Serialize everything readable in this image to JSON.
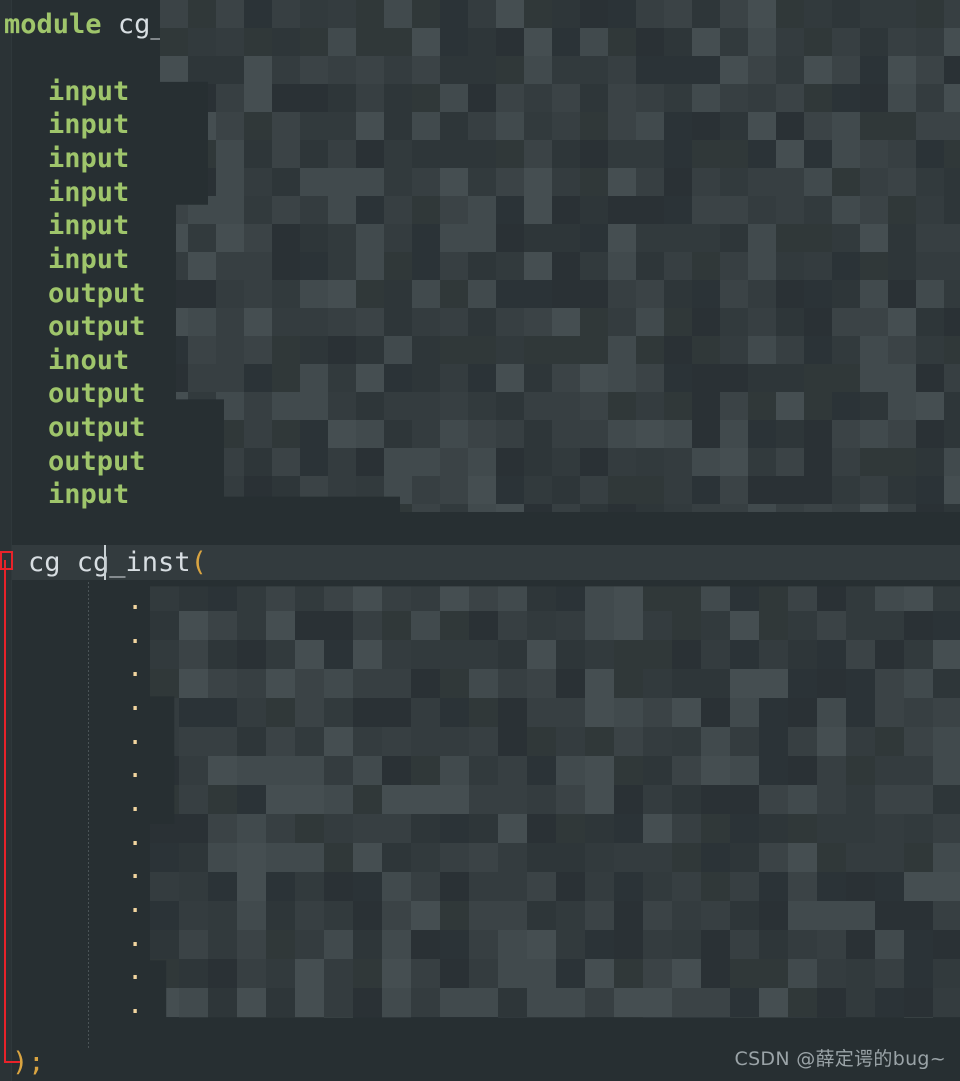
{
  "editor": {
    "background_color": "#272f32",
    "gutter_color": "#2b3336",
    "line_highlight_color": "#333b3e",
    "keyword_color": "#9fc56b",
    "identifier_color": "#d8dee2",
    "punctuation_color": "#d9a441",
    "annotation_color": "#e8232a",
    "language": "verilog"
  },
  "code": {
    "module_line": {
      "keyword": "module",
      "space": " ",
      "name": "cg_top"
    },
    "port_declarations": [
      {
        "keyword": "input"
      },
      {
        "keyword": "input"
      },
      {
        "keyword": "input"
      },
      {
        "keyword": "input"
      },
      {
        "keyword": "input"
      },
      {
        "keyword": "input"
      },
      {
        "keyword": "output"
      },
      {
        "keyword": "output"
      },
      {
        "keyword": "inout"
      },
      {
        "keyword": "output"
      },
      {
        "keyword": "output"
      },
      {
        "keyword": "output"
      },
      {
        "keyword": "input"
      }
    ],
    "instance_line": {
      "type": "cg",
      "space": " ",
      "name": "cg_inst",
      "open_paren": "("
    },
    "port_connection_dots": [
      ".",
      ".",
      ".",
      ".",
      ".",
      ".",
      ".",
      ".",
      ".",
      ".",
      ".",
      ".",
      "."
    ],
    "closing_line": {
      "close_paren": ")",
      "semicolon": ";"
    }
  },
  "annotation": {
    "marker_label": "red-bracket-marker",
    "line_label": "red-vertical-rule"
  },
  "caret": {
    "visible": true,
    "label": "text-cursor"
  },
  "watermark": {
    "text": "CSDN @薛定谔的bug~"
  }
}
